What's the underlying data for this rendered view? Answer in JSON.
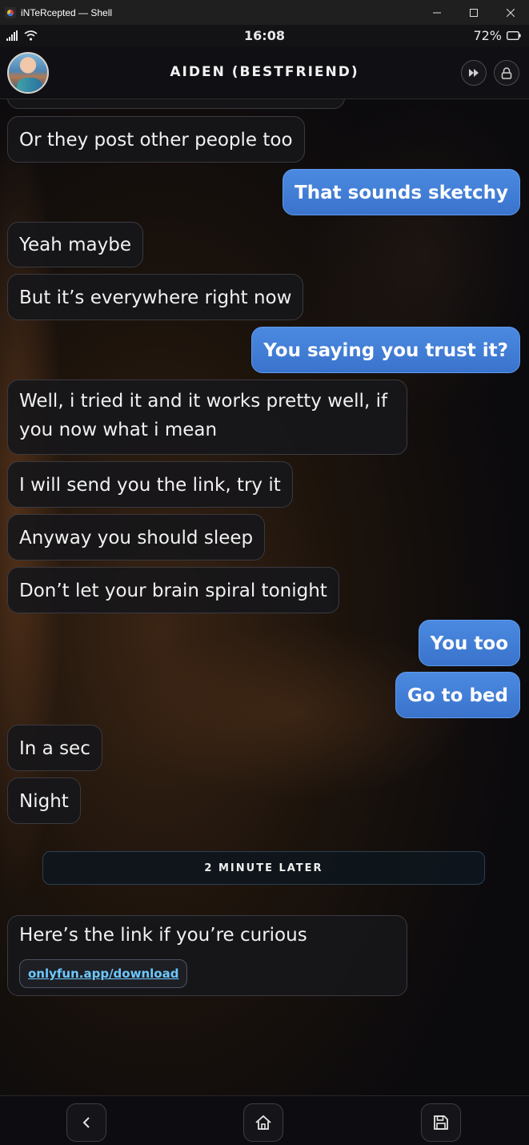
{
  "window": {
    "title": "iNTeRcepted — Shell",
    "minimize_icon": "minimize-icon",
    "maximize_icon": "maximize-icon",
    "close_icon": "close-icon"
  },
  "status_bar": {
    "time": "16:08",
    "battery": "72%"
  },
  "header": {
    "contact_name": "AIDEN (BESTFRIEND)",
    "skip_icon": "fast-forward-icon",
    "lock_icon": "lock-icon"
  },
  "messages": [
    {
      "side": "in",
      "text": "Or they post other people too"
    },
    {
      "side": "out",
      "text": "That sounds sketchy"
    },
    {
      "side": "in",
      "text": "Yeah maybe"
    },
    {
      "side": "in",
      "text": "But it’s everywhere right now"
    },
    {
      "side": "out",
      "text": "You saying you trust it?"
    },
    {
      "side": "in",
      "text": "Well, i tried it and it works pretty well, if you now what i mean"
    },
    {
      "side": "in",
      "text": "I will send you the link, try it"
    },
    {
      "side": "in",
      "text": "Anyway you should sleep"
    },
    {
      "side": "in",
      "text": "Don’t let your brain spiral tonight"
    },
    {
      "side": "out",
      "text": "You too"
    },
    {
      "side": "out",
      "text": "Go to bed"
    },
    {
      "side": "in",
      "text": "In a sec"
    },
    {
      "side": "in",
      "text": "Night"
    }
  ],
  "time_divider": "2 MINUTE LATER",
  "link_message": {
    "text": "Here’s the link if you’re curious",
    "link": "onlyfun.app/download"
  },
  "bottom_nav": {
    "back_icon": "back-icon",
    "home_icon": "home-icon",
    "save_icon": "save-icon"
  }
}
